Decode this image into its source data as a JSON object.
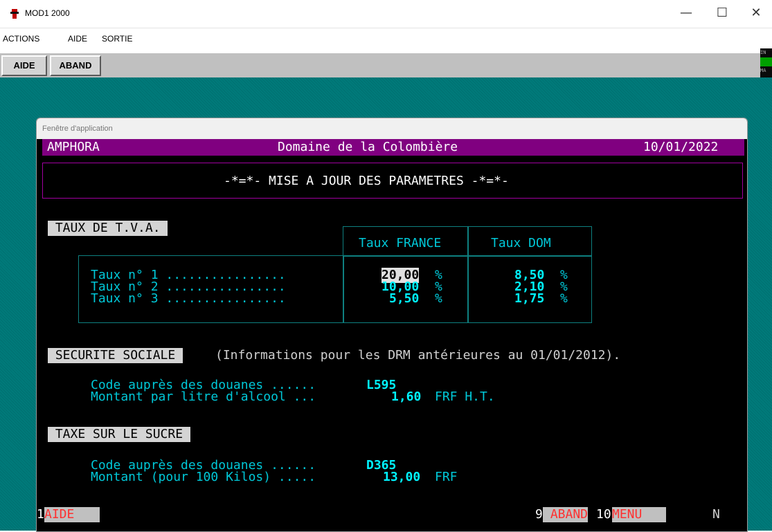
{
  "window": {
    "title": "MOD1 2000",
    "minimize": "—",
    "maximize": "☐",
    "close": "✕"
  },
  "menu": [
    "ACTIONS",
    "AIDE",
    "SORTIE"
  ],
  "toolbar": {
    "aide": "AIDE",
    "aband": "ABAND"
  },
  "indicators": [
    "IN",
    "",
    "MA"
  ],
  "app_window": {
    "caption": "Fenêtre d'application"
  },
  "header": {
    "left": "AMPHORA",
    "center": "Domaine de la Colombière",
    "right": "10/01/2022"
  },
  "screen_title": "-*=*- MISE A JOUR DES PARAMETRES -*=*-",
  "tva": {
    "label": " TAUX DE T.V.A. ",
    "col_france": "Taux FRANCE",
    "col_dom": "Taux DOM",
    "rows": [
      {
        "label": "Taux n° 1 ................",
        "france": "20,00",
        "dom": "8,50"
      },
      {
        "label": "Taux n° 2 ................",
        "france": "10,00",
        "dom": "2,10"
      },
      {
        "label": "Taux n° 3 ................",
        "france": "5,50",
        "dom": "1,75"
      }
    ],
    "pct": "%"
  },
  "secu": {
    "label": " SECURITE SOCIALE ",
    "note": "(Informations pour les DRM antérieures au 01/01/2012).",
    "code_label": "Code auprès des douanes ......",
    "code_value": "L595",
    "montant_label": "Montant par litre d'alcool ...",
    "montant_value": "1,60",
    "montant_unit": "FRF H.T."
  },
  "sucre": {
    "label": " TAXE SUR LE SUCRE ",
    "code_label": "Code auprès des douanes ......",
    "code_value": "D365",
    "montant_label": "Montant (pour 100 Kilos) .....",
    "montant_value": "13,00",
    "montant_unit": "FRF"
  },
  "footer": {
    "f1_num": "1",
    "f1_label": "AIDE",
    "f9_num": "9",
    "f9_label": " ABAND",
    "f10_num": "10",
    "f10_label": "MENU",
    "mode": "N"
  }
}
